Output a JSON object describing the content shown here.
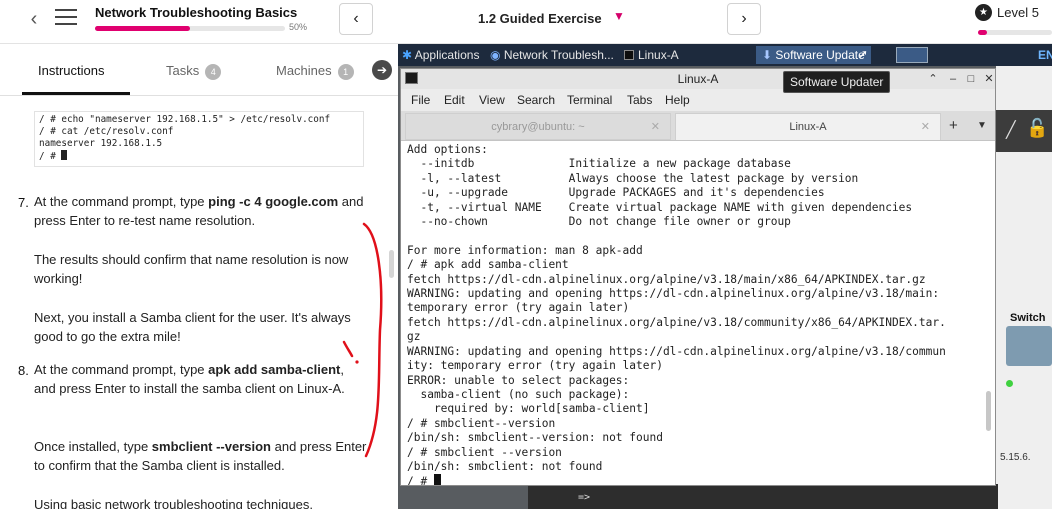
{
  "header": {
    "course_title": "Network Troubleshooting Basics",
    "progress_percent": 50,
    "progress_label": "50%",
    "prev_label": "‹",
    "next_label": "›",
    "exercise_title": "1.2 Guided Exercise",
    "level_label": "Level 5",
    "level_progress_percent": 12
  },
  "left": {
    "tabs": [
      {
        "label": "Instructions"
      },
      {
        "label": "Tasks",
        "count": "4"
      },
      {
        "label": "Machines",
        "count": "1"
      }
    ],
    "code_lines": [
      "/ # echo \"nameserver 192.168.1.5\" > /etc/resolv.conf",
      "/ # cat /etc/resolv.conf",
      "nameserver 192.168.1.5",
      "/ # "
    ],
    "steps": {
      "s7_num": "7.",
      "s7_a": "At the command prompt, type ",
      "s7_cmd": "ping -c 4 google.com",
      "s7_b": " and press Enter to re-test name resolution.",
      "p1": "The results should confirm that name resolution is now working!",
      "p2": "Next, you install a Samba client for the user. It's always good to go the extra mile!",
      "s8_num": "8.",
      "s8_a": "At the command prompt, type ",
      "s8_cmd": "apk add samba-client",
      "s8_b": ", and press Enter to install the samba client on Linux-A.",
      "p3_a": "Once installed, type ",
      "p3_cmd": "smbclient --version",
      "p3_b": " and press Enter to confirm that the Samba client is installed.",
      "p4": "Using basic network troubleshooting techniques,"
    }
  },
  "desktop": {
    "taskbar": {
      "applications": "Applications",
      "browser": "Network Troublesh...",
      "terminal": "Linux-A",
      "updater": "Software Update",
      "extra": "EN"
    },
    "tooltip": "Software Updater",
    "side": {
      "switch_label": "Switch",
      "version": "5.15.6.",
      "bottom_prompt": "=>"
    },
    "terminal": {
      "title": "Linux-A",
      "menu": [
        "File",
        "Edit",
        "View",
        "Search",
        "Terminal",
        "Tabs",
        "Help"
      ],
      "tabs": [
        {
          "label": "cybrary@ubuntu: ~"
        },
        {
          "label": "Linux-A"
        }
      ],
      "add_tab": "+",
      "lines": [
        "Add options:",
        "  --initdb              Initialize a new package database",
        "  -l, --latest          Always choose the latest package by version",
        "  -u, --upgrade         Upgrade PACKAGES and it's dependencies",
        "  -t, --virtual NAME    Create virtual package NAME with given dependencies",
        "  --no-chown            Do not change file owner or group",
        "",
        "For more information: man 8 apk-add",
        "/ # apk add samba-client",
        "fetch https://dl-cdn.alpinelinux.org/alpine/v3.18/main/x86_64/APKINDEX.tar.gz",
        "WARNING: updating and opening https://dl-cdn.alpinelinux.org/alpine/v3.18/main:",
        "temporary error (try again later)",
        "fetch https://dl-cdn.alpinelinux.org/alpine/v3.18/community/x86_64/APKINDEX.tar.",
        "gz",
        "WARNING: updating and opening https://dl-cdn.alpinelinux.org/alpine/v3.18/commun",
        "ity: temporary error (try again later)",
        "ERROR: unable to select packages:",
        "  samba-client (no such package):",
        "    required by: world[samba-client]",
        "/ # smbclient--version",
        "/bin/sh: smbclient--version: not found",
        "/ # smbclient --version",
        "/bin/sh: smbclient: not found",
        "/ # "
      ]
    }
  },
  "colors": {
    "accent": "#e0006f",
    "taskbar": "#1d2a3d",
    "annotation": "#e0101a"
  }
}
